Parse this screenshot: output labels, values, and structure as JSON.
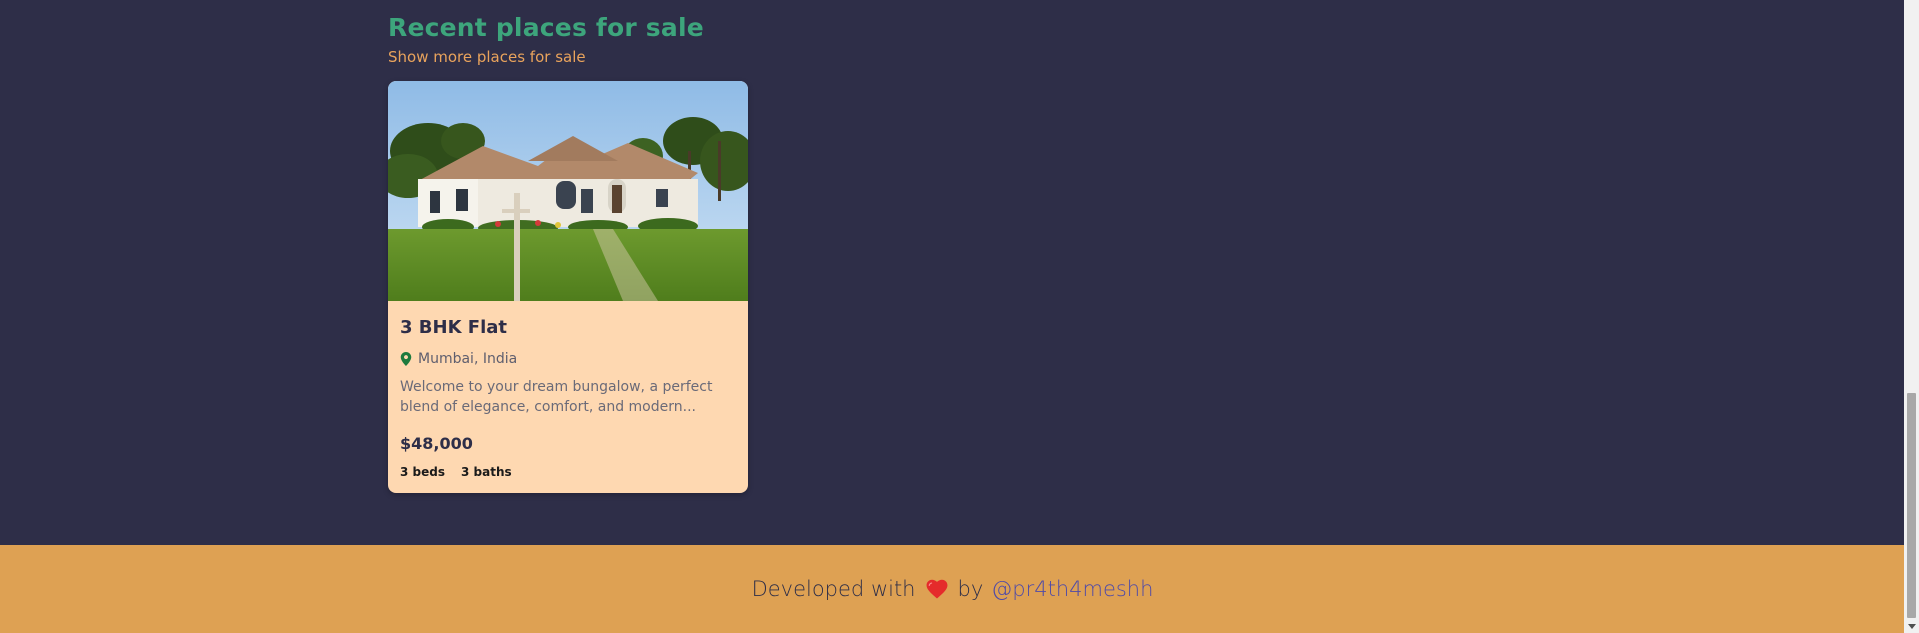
{
  "section": {
    "title": "Recent places for sale",
    "show_more_label": "Show more places for sale"
  },
  "listings": [
    {
      "title": "3 BHK Flat",
      "location": "Mumbai, India",
      "description": "Welcome to your dream bungalow, a perfect blend of elegance, comfort, and modern...",
      "price": "$48,000",
      "beds": "3 beds",
      "baths": "3 baths"
    }
  ],
  "footer": {
    "prefix": "Developed with",
    "middle": "by",
    "handle": "@pr4th4meshh"
  },
  "colors": {
    "background": "#2e2e48",
    "accent_green": "#3da57c",
    "link_orange": "#e9a35c",
    "card_bg": "#fed8b1",
    "footer_bg": "#dea153",
    "handle_purple": "#4f4aa8",
    "heart_red": "#e52b2b",
    "pin_green": "#1d7a3e"
  },
  "icons": {
    "location": "map-pin-icon",
    "heart": "heart-icon"
  }
}
